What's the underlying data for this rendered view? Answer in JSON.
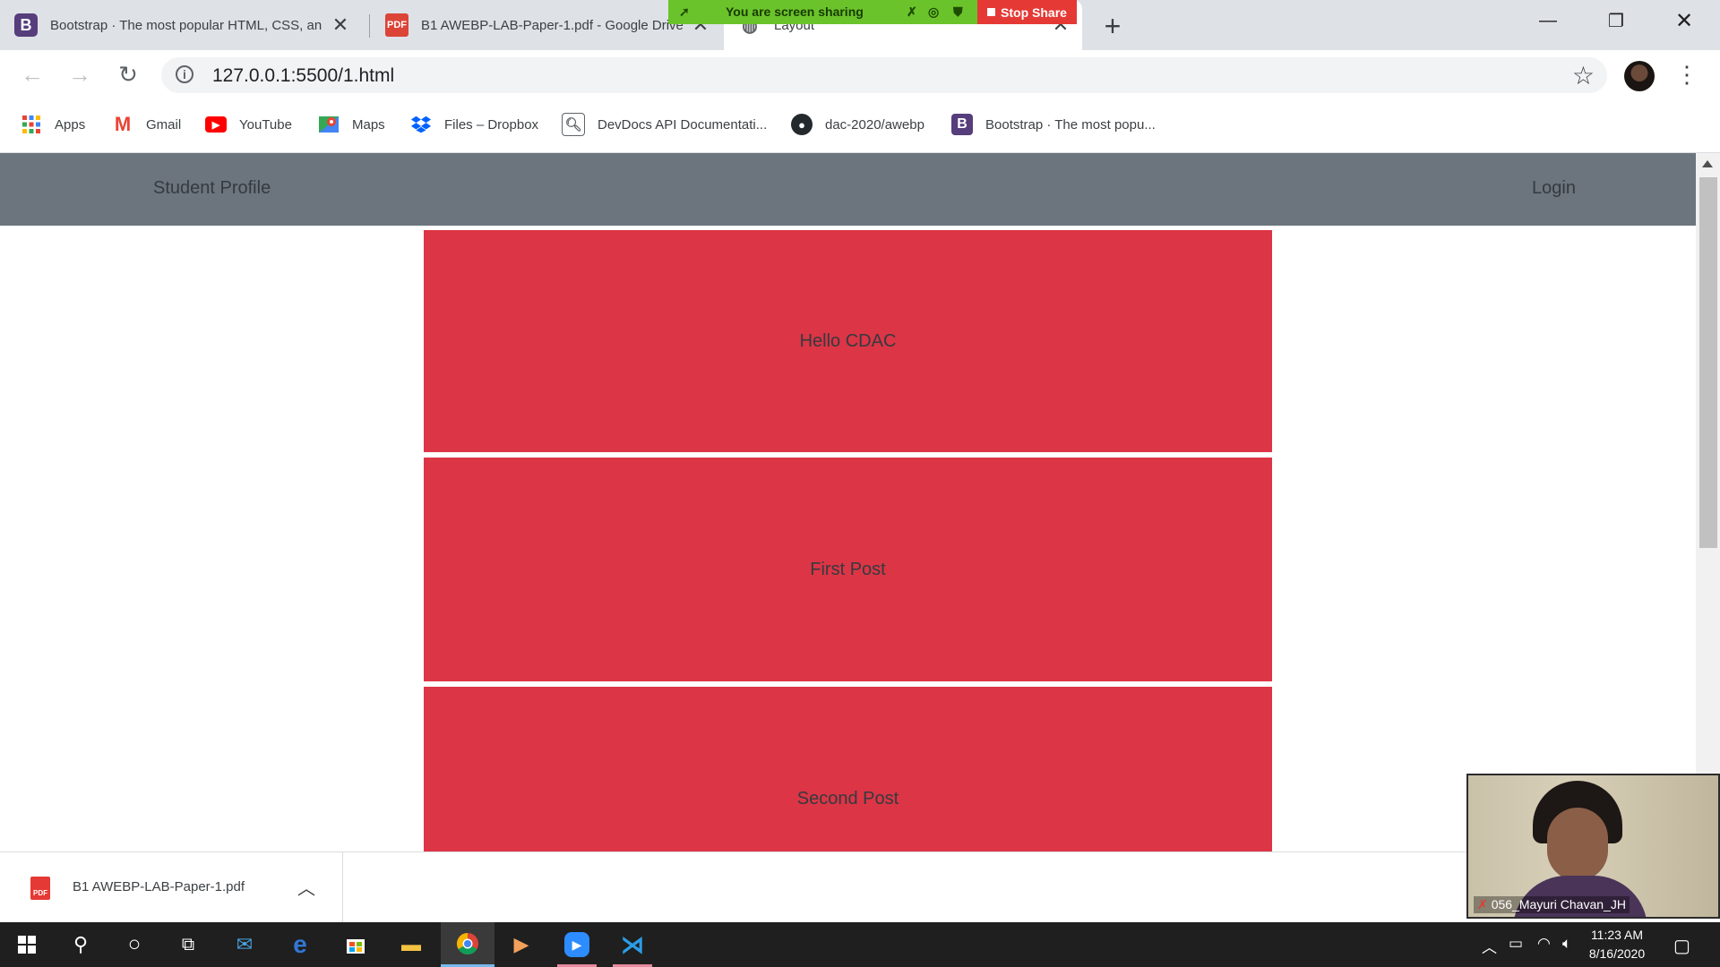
{
  "browser": {
    "tabs": [
      {
        "icon": "bootstrap-icon",
        "favicon_text": "B",
        "title": "Bootstrap · The most popular HTML, CSS, an"
      },
      {
        "icon": "pdf-icon",
        "favicon_text": "PDF",
        "title": "B1 AWEBP-LAB-Paper-1.pdf - Google Drive"
      },
      {
        "icon": "globe-icon",
        "favicon_text": "",
        "title": "Layout"
      }
    ],
    "url": "127.0.0.1:5500/1.html",
    "bookmarks": [
      {
        "label": "Apps",
        "icon": "apps-grid-icon"
      },
      {
        "label": "Gmail",
        "icon": "gmail-icon",
        "glyph": "M"
      },
      {
        "label": "YouTube",
        "icon": "youtube-icon",
        "glyph": "▶"
      },
      {
        "label": "Maps",
        "icon": "maps-icon"
      },
      {
        "label": "Files – Dropbox",
        "icon": "dropbox-icon"
      },
      {
        "label": "DevDocs API Documentati...",
        "icon": "devdocs-icon"
      },
      {
        "label": "dac-2020/awebp",
        "icon": "github-icon"
      },
      {
        "label": "Bootstrap · The most popu...",
        "icon": "bootstrap-icon",
        "glyph": "B"
      }
    ],
    "colors": {
      "bootstrap": "#563d7c",
      "pdf": "#db4437"
    }
  },
  "screen_share": {
    "message": "You are screen sharing",
    "stop_label": "Stop Share"
  },
  "page": {
    "navbar": {
      "brand": "Student Profile",
      "login": "Login",
      "background": "#6c757d"
    },
    "posts": [
      {
        "text": "Hello CDAC"
      },
      {
        "text": "First Post"
      },
      {
        "text": "Second Post"
      }
    ],
    "post_color": "#dc3545"
  },
  "downloads": {
    "file_name": "B1 AWEBP-LAB-Paper-1.pdf"
  },
  "video": {
    "participant": "056_Mayuri Chavan_JH"
  },
  "taskbar": {
    "apps": [
      "windows-start-icon",
      "search-icon",
      "cortana-icon",
      "task-view-icon",
      "mail-icon",
      "edge-icon",
      "store-icon",
      "file-explorer-icon",
      "chrome-icon",
      "media-player-icon",
      "zoom-icon",
      "vscode-icon"
    ],
    "time": "11:23 AM",
    "date": "8/16/2020"
  }
}
